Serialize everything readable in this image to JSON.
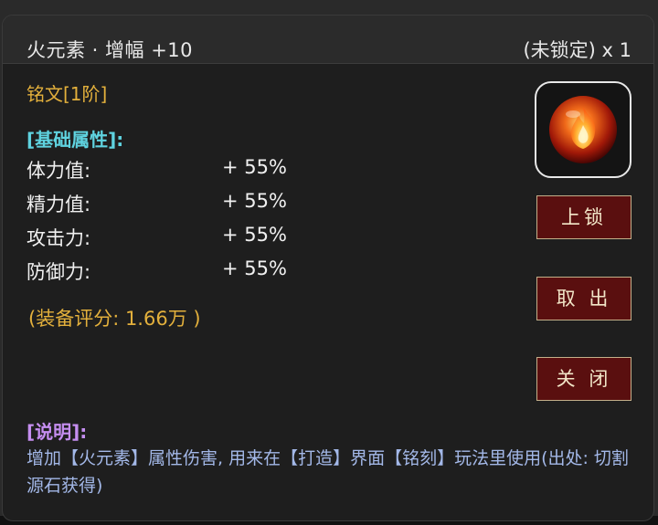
{
  "header": {
    "title": "火元素 · 增幅 +10",
    "count": "(未锁定) x 1"
  },
  "item": {
    "type_label": "铭文[1阶]",
    "icon": "fire-orb-icon"
  },
  "attributes": {
    "heading": "[基础属性]:",
    "rows": [
      {
        "name": "体力值:",
        "value": "+ 55%"
      },
      {
        "name": "精力值:",
        "value": "+ 55%"
      },
      {
        "name": "攻击力:",
        "value": "+ 55%"
      },
      {
        "name": "防御力:",
        "value": "+ 55%"
      }
    ],
    "score": "(装备评分: 1.66万 )"
  },
  "description": {
    "heading": "[说明]:",
    "text": "增加【火元素】属性伤害, 用来在【打造】界面【铭刻】玩法里使用(出处: 切割源石获得)"
  },
  "buttons": {
    "lock": "上锁",
    "take_out": "取 出",
    "close": "关 闭"
  },
  "colors": {
    "gold": "#e3b03c",
    "cyan": "#5fd3e0",
    "purple": "#c58ef0",
    "desc_blue": "#a3b8e8",
    "button_red": "#5a0f0f"
  }
}
